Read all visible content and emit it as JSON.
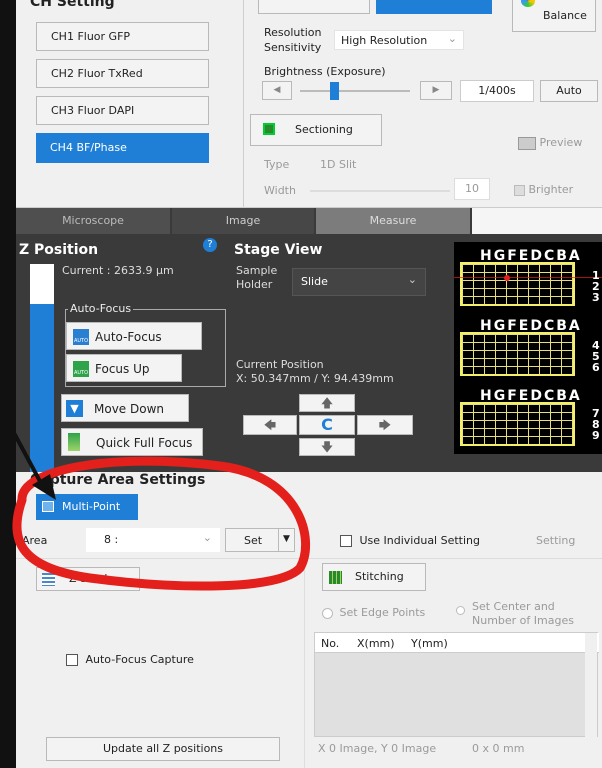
{
  "ch_setting": {
    "title": "CH Setting",
    "channels": [
      "CH1 Fluor GFP",
      "CH2 Fluor TxRed",
      "CH3 Fluor DAPI",
      "CH4 BF/Phase"
    ],
    "selected_index": 3,
    "balance_label": "Balance",
    "resolution_label": "Resolution Sensitivity",
    "resolution_value": "High Resolution",
    "brightness_label": "Brightness (Exposure)",
    "exposure_value": "1/400s",
    "auto_label": "Auto",
    "sectioning_label": "Sectioning",
    "preview_label": "Preview",
    "type_label": "Type",
    "type_value": "1D Slit",
    "width_label": "Width",
    "width_value": "10",
    "brighter_label": "Brighter"
  },
  "tabs": [
    "Microscope",
    "Image",
    "Measure"
  ],
  "z_position": {
    "title": "Z Position",
    "help": "?",
    "current": "Current : 2633.9 μm",
    "autofocus_group": "Auto-Focus",
    "autofocus_button": "Auto-Focus",
    "focus_up": "Focus Up",
    "move_down": "Move Down",
    "quick_full_focus": "Quick Full Focus"
  },
  "stage_view": {
    "title": "Stage View",
    "sample_holder_label": "Sample Holder",
    "sample_holder_value": "Slide",
    "current_position_label": "Current Position",
    "current_position_value": "X: 50.347mm / Y: 94.439mm",
    "center_label": "C",
    "slide_columns": "HGFEDCBA",
    "slide_numbers": [
      [
        "1",
        "2",
        "3"
      ],
      [
        "4",
        "5",
        "6"
      ],
      [
        "7",
        "8",
        "9"
      ]
    ]
  },
  "capture_area": {
    "title": "Capture Area Settings",
    "multipoint": "Multi-Point",
    "area_label": "Area",
    "area_value": "8 :",
    "set_label": "Set",
    "use_individual": "Use Individual Setting",
    "setting_label": "Setting",
    "zstack_label": "Z-Stack",
    "stitching_label": "Stitching",
    "set_edge_points": "Set Edge Points",
    "set_center_images": "Set Center and Number of Images",
    "table_headers": [
      "No.",
      "X(mm)",
      "Y(mm)"
    ],
    "autofocus_capture": "Auto-Focus Capture",
    "update_z": "Update all Z positions",
    "status_images": "X 0 Image, Y 0 Image",
    "status_size": "0 x 0 mm"
  },
  "colors": {
    "selected_blue": "#1f7fd6",
    "annotation_red": "#e3201b",
    "slide_yellow": "#f4f06a"
  }
}
